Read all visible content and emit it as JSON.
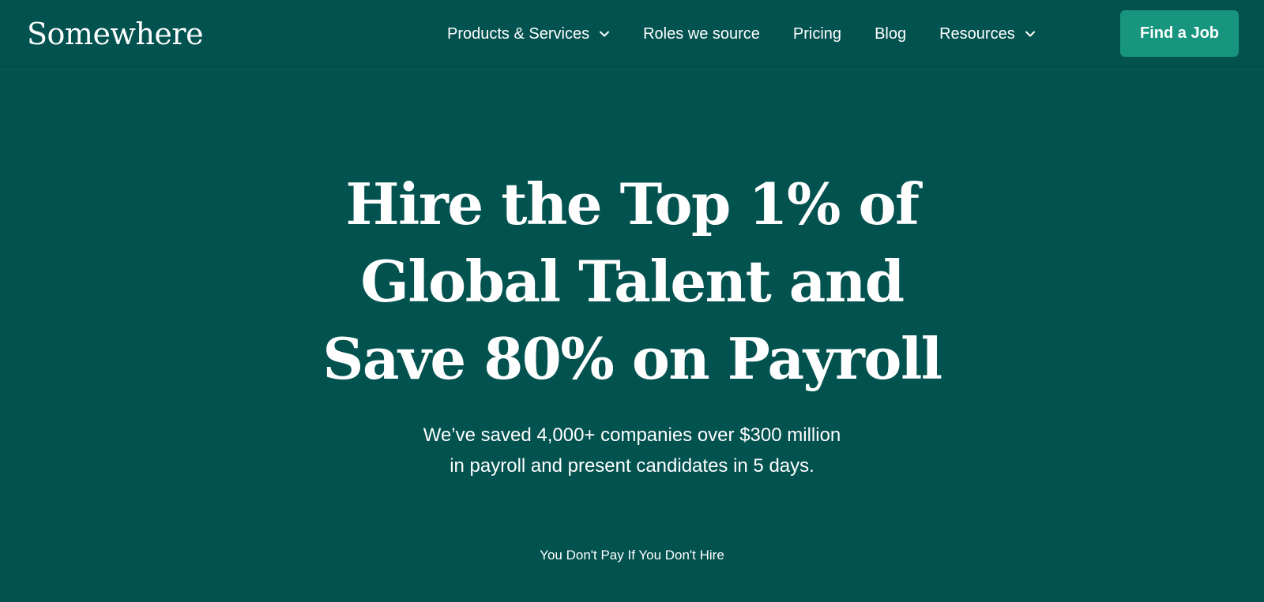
{
  "header": {
    "logo": "Somewhere",
    "nav": [
      {
        "label": "Products & Services",
        "has_dropdown": true
      },
      {
        "label": "Roles we source",
        "has_dropdown": false
      },
      {
        "label": "Pricing",
        "has_dropdown": false
      },
      {
        "label": "Blog",
        "has_dropdown": false
      },
      {
        "label": "Resources",
        "has_dropdown": true
      }
    ],
    "cta_label": "Find a Job"
  },
  "hero": {
    "headline_lines": [
      "Hire the Top 1% of",
      "Global Talent and",
      "Save 80% on Payroll"
    ],
    "subtext_lines": [
      "We’ve saved 4,000+ companies over $300 million",
      "in payroll and present candidates in 5 days."
    ],
    "tagline": "You Don't Pay If You Don't Hire"
  },
  "colors": {
    "background": "#02524F",
    "cta_button": "#17957E",
    "text": "#FFFFFF"
  },
  "icons": {
    "dropdown": "chevron-down-icon"
  }
}
